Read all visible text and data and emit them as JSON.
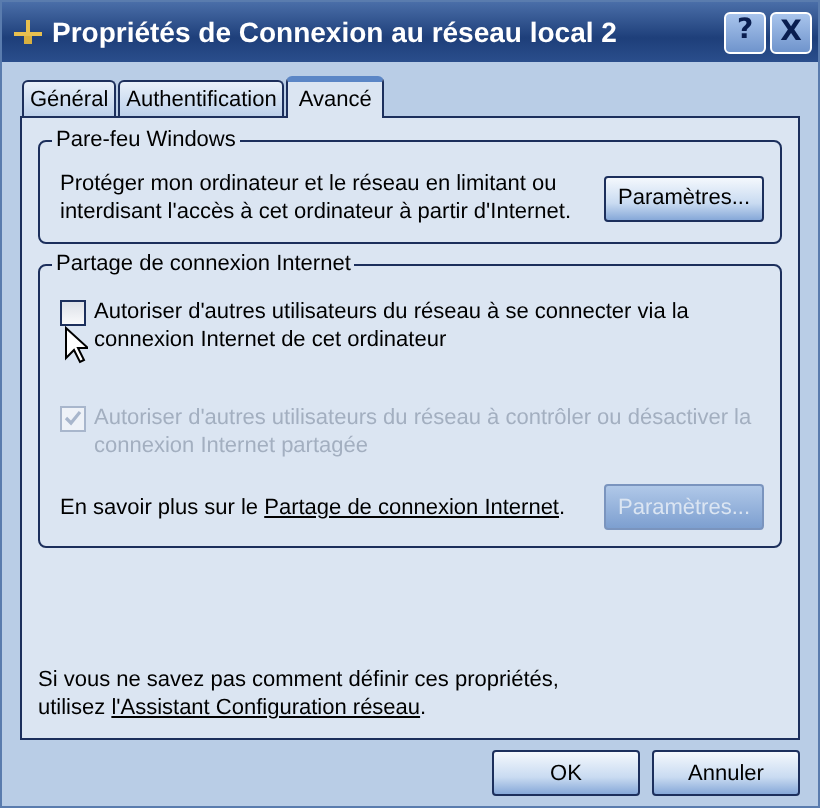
{
  "window": {
    "title": "Propriétés de Connexion au réseau local 2",
    "controls": [
      {
        "kind": "help",
        "label": "?"
      },
      {
        "kind": "close",
        "label": "X"
      }
    ]
  },
  "tabs": [
    {
      "label": "Général",
      "selected": false
    },
    {
      "label": "Authentification",
      "selected": false
    },
    {
      "label": "Avancé",
      "selected": true
    }
  ],
  "firewall": {
    "title": "Pare-feu Windows",
    "text": "Protéger mon ordinateur et le réseau en limitant ou interdisant l'accès à cet ordinateur à partir d'Internet.",
    "button": {
      "label": "Paramètres...",
      "disabled": false
    }
  },
  "sharing": {
    "title": "Partage de connexion Internet",
    "options": [
      {
        "label": "Autoriser d'autres utilisateurs du réseau à se connecter via la connexion Internet de cet ordinateur",
        "checked": false,
        "disabled": false
      },
      {
        "label": "Autoriser d'autres utilisateurs du réseau à contrôler ou désactiver la connexion Internet partagée",
        "checked": true,
        "disabled": true
      }
    ],
    "info": {
      "before": "En savoir plus sur le ",
      "link": "Partage de connexion Internet",
      "after": "."
    },
    "button": {
      "label": "Paramètres...",
      "disabled": true
    }
  },
  "help": {
    "line1": "Si vous ne savez pas comment définir ces propriétés,",
    "before": "utilisez ",
    "link": "l'Assistant Configuration réseau",
    "after": "."
  },
  "buttons": [
    {
      "label": "OK"
    },
    {
      "label": "Annuler"
    }
  ]
}
